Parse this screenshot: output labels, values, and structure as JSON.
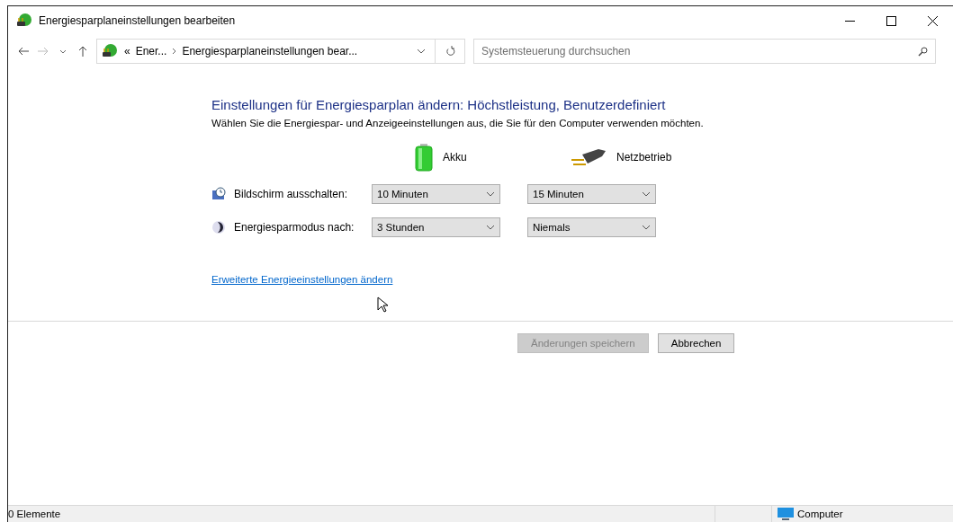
{
  "window": {
    "title": "Energiesparplaneinstellungen bearbeiten"
  },
  "address_bar": {
    "overflow": "«",
    "crumbs": [
      "Ener...",
      "Energiesparplaneinstellungen bear..."
    ]
  },
  "search": {
    "placeholder": "Systemsteuerung durchsuchen"
  },
  "heading": "Einstellungen für Energiesparplan ändern: Höchstleistung, Benutzerdefiniert",
  "description": "Wählen Sie die Energiespar- und Anzeigeeinstellungen aus, die Sie für den Computer verwenden möchten.",
  "columns": [
    {
      "kind": "battery",
      "label": "Akku"
    },
    {
      "kind": "plug",
      "label": "Netzbetrieb"
    }
  ],
  "settings": [
    {
      "kind": "display",
      "label": "Bildschirm ausschalten:",
      "values": [
        "10 Minuten",
        "15 Minuten"
      ]
    },
    {
      "kind": "sleep",
      "label": "Energiesparmodus nach:",
      "values": [
        "3 Stunden",
        "Niemals"
      ]
    }
  ],
  "advanced_link": "Erweiterte Energieeinstellungen ändern",
  "buttons": [
    {
      "label": "Änderungen speichern",
      "disabled": true
    },
    {
      "label": "Abbrechen",
      "disabled": false
    }
  ],
  "status_bar": {
    "items": "0 Elemente",
    "location": "Computer"
  }
}
